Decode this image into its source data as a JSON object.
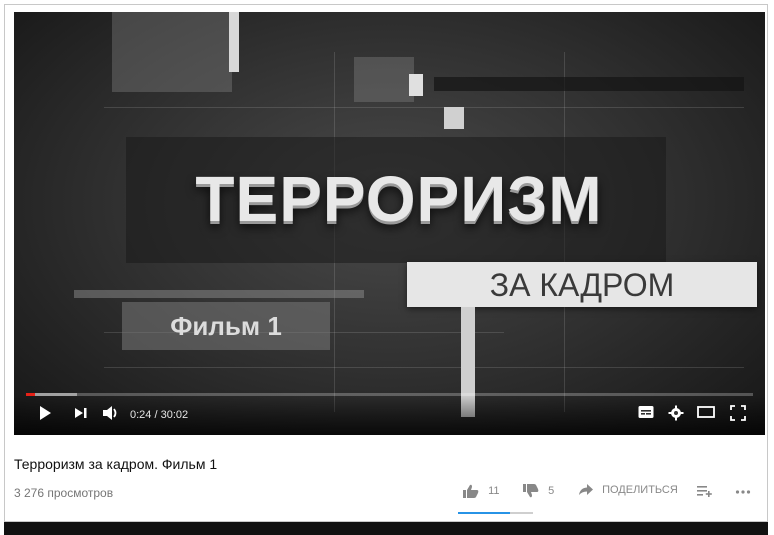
{
  "video": {
    "headline": "ТЕРРОРИЗМ",
    "subheadline": "ЗА КАДРОМ",
    "film_label": "Фильм 1"
  },
  "player": {
    "time_display": "0:24 / 30:02",
    "progress_fraction": 0.013,
    "buffered_fraction": 0.07,
    "icons": [
      "play-icon",
      "next-icon",
      "volume-icon",
      "subtitles-icon",
      "settings-icon",
      "theater-mode-icon",
      "fullscreen-icon"
    ]
  },
  "meta": {
    "title": "Терроризм за кадром. Фильм 1",
    "views": "3 276 просмотров"
  },
  "actions": {
    "like_count": "11",
    "dislike_count": "5",
    "share_label": "ПОДЕЛИТЬСЯ",
    "like_ratio": 0.69,
    "icons": [
      "thumbs-up-icon",
      "thumbs-down-icon",
      "share-icon",
      "add-to-playlist-icon",
      "more-icon"
    ]
  },
  "colors": {
    "progress": "#e62117",
    "like_bar": "#2793e6"
  }
}
